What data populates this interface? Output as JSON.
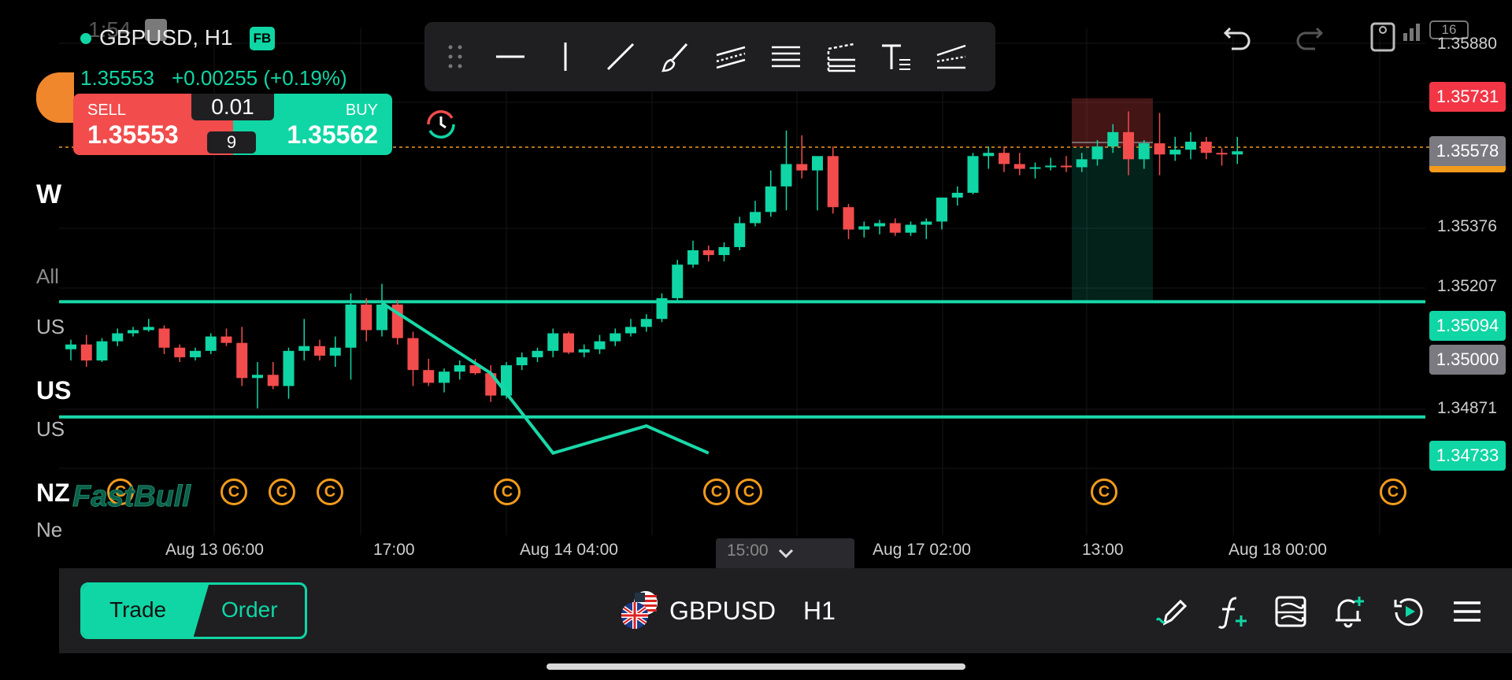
{
  "status_bar": {
    "time": "1:54",
    "battery": "16"
  },
  "header": {
    "symbol_timeframe": "GBPUSD, H1",
    "badge": "FB",
    "last_price": "1.35553",
    "change": "+0.00255 (+0.19%)"
  },
  "trade_panel": {
    "sell_label": "SELL",
    "sell_price": "1.35553",
    "buy_label": "BUY",
    "buy_price": "1.35562",
    "lot_size": "0.01",
    "spread": "9"
  },
  "left_strip": {
    "items": [
      "W",
      "All",
      "US",
      "US",
      "US",
      "NZ",
      "Ne"
    ]
  },
  "toolbar": {
    "tools": [
      "drag-handle-icon",
      "horizontal-line-icon",
      "vertical-line-icon",
      "trend-line-icon",
      "brush-icon",
      "parallel-channel-icon",
      "fib-retracement-icon",
      "fib-extension-icon",
      "text-tool-icon",
      "pitchfork-icon"
    ]
  },
  "price_axis": {
    "labels": [
      "1.35880",
      "1.35376",
      "1.35207",
      "1.34871"
    ],
    "tags": {
      "stop_loss": "1.35731",
      "current": "1.35578",
      "upper_line": "1.35094",
      "round_level": "1.35000",
      "lower_line": "1.34733"
    }
  },
  "time_axis": {
    "labels": [
      "Aug 13 06:00",
      "17:00",
      "Aug 14 04:00",
      "15:00",
      "Aug 17 02:00",
      "13:00",
      "Aug 18 00:00"
    ]
  },
  "watermark": "FastBull",
  "event_markers": [
    "C",
    "C",
    "C",
    "C",
    "C",
    "C",
    "C",
    "C",
    "C",
    "C"
  ],
  "bottom_bar": {
    "trade_tab": "Trade",
    "order_tab": "Order",
    "symbol": "GBPUSD",
    "timeframe": "H1",
    "icons": [
      "draw-pencil-icon",
      "indicator-fx-icon",
      "template-icon",
      "alert-add-icon",
      "replay-icon",
      "menu-icon"
    ]
  },
  "colors": {
    "bull": "#0fd6a4",
    "bear": "#f24c4c",
    "accent_orange": "#f39b1c",
    "background": "#000000"
  },
  "chart_data": {
    "type": "candlestick",
    "symbol": "GBPUSD",
    "interval": "H1",
    "ylim": [
      1.3456,
      1.3595
    ],
    "horizontal_levels": [
      1.35094,
      1.34733
    ],
    "current_price": 1.35578,
    "position": {
      "entry": 1.35578,
      "stop": 1.35731,
      "target": 1.35094
    },
    "candles": [
      [
        1.34945,
        1.34975,
        1.3491,
        1.3496
      ],
      [
        1.3496,
        1.3499,
        1.3489,
        1.3491
      ],
      [
        1.3491,
        1.3498,
        1.34905,
        1.3497
      ],
      [
        1.3497,
        1.3501,
        1.34955,
        1.34995
      ],
      [
        1.34995,
        1.35015,
        1.34985,
        1.35005
      ],
      [
        1.35005,
        1.3504,
        1.35,
        1.35015
      ],
      [
        1.3501,
        1.3502,
        1.3493,
        1.3495
      ],
      [
        1.3495,
        1.3496,
        1.34905,
        1.3492
      ],
      [
        1.3492,
        1.3495,
        1.3491,
        1.3494
      ],
      [
        1.3494,
        1.34995,
        1.3493,
        1.34985
      ],
      [
        1.34985,
        1.3501,
        1.34955,
        1.34965
      ],
      [
        1.34965,
        1.35015,
        1.3483,
        1.34855
      ],
      [
        1.34855,
        1.34905,
        1.3476,
        1.34865
      ],
      [
        1.34865,
        1.34905,
        1.3482,
        1.3483
      ],
      [
        1.3483,
        1.3495,
        1.3479,
        1.3494
      ],
      [
        1.3494,
        1.3504,
        1.3491,
        1.34955
      ],
      [
        1.34955,
        1.34975,
        1.3491,
        1.34925
      ],
      [
        1.34925,
        1.34985,
        1.3489,
        1.3495
      ],
      [
        1.3495,
        1.3512,
        1.3485,
        1.35085
      ],
      [
        1.35085,
        1.35105,
        1.3497,
        1.35005
      ],
      [
        1.35005,
        1.3515,
        1.34985,
        1.35085
      ],
      [
        1.35085,
        1.351,
        1.3496,
        1.3498
      ],
      [
        1.3498,
        1.35,
        1.3483,
        1.3488
      ],
      [
        1.3488,
        1.34915,
        1.3483,
        1.3484
      ],
      [
        1.3484,
        1.34885,
        1.3481,
        1.34875
      ],
      [
        1.34875,
        1.3491,
        1.3485,
        1.34895
      ],
      [
        1.34895,
        1.34915,
        1.34865,
        1.3487
      ],
      [
        1.3487,
        1.34895,
        1.3478,
        1.348
      ],
      [
        1.348,
        1.34905,
        1.3479,
        1.34895
      ],
      [
        1.34895,
        1.34935,
        1.3488,
        1.3492
      ],
      [
        1.3492,
        1.3495,
        1.34905,
        1.3494
      ],
      [
        1.3494,
        1.3501,
        1.3492,
        1.34995
      ],
      [
        1.34995,
        1.35,
        1.3493,
        1.34935
      ],
      [
        1.34935,
        1.3496,
        1.3492,
        1.34945
      ],
      [
        1.34945,
        1.3499,
        1.3493,
        1.3497
      ],
      [
        1.3497,
        1.3501,
        1.34955,
        1.34995
      ],
      [
        1.34995,
        1.3504,
        1.34985,
        1.35015
      ],
      [
        1.35015,
        1.35055,
        1.35,
        1.3504
      ],
      [
        1.3504,
        1.3512,
        1.3503,
        1.35105
      ],
      [
        1.35105,
        1.35225,
        1.35095,
        1.3521
      ],
      [
        1.3521,
        1.35285,
        1.352,
        1.35255
      ],
      [
        1.35255,
        1.3527,
        1.3522,
        1.3524
      ],
      [
        1.3524,
        1.3528,
        1.3522,
        1.35265
      ],
      [
        1.35265,
        1.3536,
        1.35255,
        1.3534
      ],
      [
        1.3534,
        1.3541,
        1.3533,
        1.35375
      ],
      [
        1.35375,
        1.35505,
        1.3536,
        1.35455
      ],
      [
        1.35455,
        1.3563,
        1.3538,
        1.35525
      ],
      [
        1.35525,
        1.35615,
        1.3548,
        1.35505
      ],
      [
        1.35505,
        1.35545,
        1.3538,
        1.3555
      ],
      [
        1.3555,
        1.3558,
        1.3537,
        1.3539
      ],
      [
        1.3539,
        1.354,
        1.3529,
        1.3532
      ],
      [
        1.3532,
        1.35345,
        1.35295,
        1.3533
      ],
      [
        1.3533,
        1.3535,
        1.35305,
        1.3534
      ],
      [
        1.3534,
        1.35355,
        1.353,
        1.3531
      ],
      [
        1.3531,
        1.35345,
        1.353,
        1.35335
      ],
      [
        1.35335,
        1.35355,
        1.3529,
        1.35345
      ],
      [
        1.35345,
        1.3542,
        1.3532,
        1.3542
      ],
      [
        1.3542,
        1.35455,
        1.35395,
        1.35435
      ],
      [
        1.35435,
        1.3556,
        1.3543,
        1.3555
      ],
      [
        1.3555,
        1.3558,
        1.3551,
        1.3556
      ],
      [
        1.3556,
        1.3558,
        1.355,
        1.35525
      ],
      [
        1.35525,
        1.3556,
        1.3549,
        1.3551
      ],
      [
        1.3551,
        1.3553,
        1.3548,
        1.35515
      ],
      [
        1.35515,
        1.35545,
        1.35505,
        1.3552
      ],
      [
        1.3552,
        1.3555,
        1.355,
        1.35515
      ],
      [
        1.35515,
        1.3556,
        1.355,
        1.3554
      ],
      [
        1.3554,
        1.356,
        1.3552,
        1.3558
      ],
      [
        1.3558,
        1.3565,
        1.3556,
        1.35625
      ],
      [
        1.35625,
        1.3569,
        1.3549,
        1.3554
      ],
      [
        1.3554,
        1.356,
        1.3551,
        1.3559
      ],
      [
        1.3559,
        1.35685,
        1.3549,
        1.35555
      ],
      [
        1.35555,
        1.3561,
        1.35535,
        1.3557
      ],
      [
        1.3557,
        1.35625,
        1.3554,
        1.35595
      ],
      [
        1.35595,
        1.3561,
        1.3554,
        1.3556
      ],
      [
        1.3556,
        1.35575,
        1.3552,
        1.35555
      ],
      [
        1.35555,
        1.3561,
        1.35525,
        1.35565
      ]
    ],
    "zigzag": [
      [
        20,
        1.3509
      ],
      [
        27,
        1.3487
      ],
      [
        31,
        1.3462
      ],
      [
        37,
        1.34705
      ],
      [
        41,
        1.3462
      ]
    ]
  }
}
